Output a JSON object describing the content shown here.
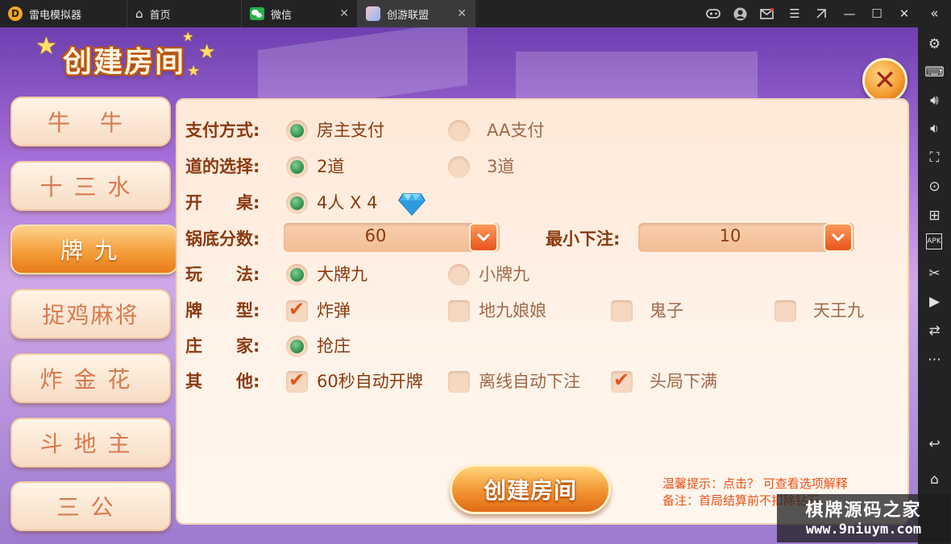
{
  "titlebar": {
    "app_name": "雷电模拟器",
    "tabs": [
      {
        "label": "首页"
      },
      {
        "label": "微信"
      },
      {
        "label": "创游联盟"
      }
    ]
  },
  "game": {
    "header_title": "创建房间",
    "game_list": [
      {
        "label": "牛  牛"
      },
      {
        "label": "十三水"
      },
      {
        "label": "牌九"
      },
      {
        "label": "捉鸡麻将"
      },
      {
        "label": "炸金花"
      },
      {
        "label": "斗地主"
      },
      {
        "label": "三公"
      }
    ],
    "active_game": "牌九",
    "form": {
      "payment": {
        "label": "支付方式:",
        "options": [
          "房主支付",
          "AA支付"
        ],
        "selected": "房主支付"
      },
      "lanes": {
        "label": "道的选择:",
        "options": [
          "2道",
          "3道"
        ],
        "selected": "2道"
      },
      "table": {
        "label": "开　　桌:",
        "option": "4人 X 4",
        "selected": true
      },
      "base_score": {
        "label": "锅底分数:",
        "value": "60"
      },
      "min_bet": {
        "label": "最小下注:",
        "value": "10"
      },
      "play_mode": {
        "label": "玩　　法:",
        "options": [
          "大牌九",
          "小牌九"
        ],
        "selected": "大牌九"
      },
      "card_types": {
        "label": "牌　　型:",
        "options": [
          {
            "text": "炸弹",
            "checked": true
          },
          {
            "text": "地九娘娘",
            "checked": false
          },
          {
            "text": "鬼子",
            "checked": false
          },
          {
            "text": "天王九",
            "checked": false
          }
        ]
      },
      "banker": {
        "label": "庄　　家:",
        "option": "抢庄",
        "selected": true
      },
      "other": {
        "label": "其　　他:",
        "options": [
          {
            "text": "60秒自动开牌",
            "checked": true
          },
          {
            "text": "离线自动下注",
            "checked": false
          },
          {
            "text": "头局下满",
            "checked": true
          }
        ]
      }
    },
    "create_button": "创建房间",
    "hint1": "温馨提示：点击？ 可查看选项解释",
    "hint2": "备注：首局结算前不扣除钻石"
  },
  "watermark": {
    "line1": "棋牌源码之家",
    "line2": "www.9niuym.com"
  },
  "colors": {
    "accent": "#f29432",
    "label": "#8a3a10",
    "radio_on": "#2d8a4c",
    "check_on": "#e1541b",
    "hint": "#e8531a"
  },
  "icons": [
    "app-logo-icon",
    "home-icon",
    "wechat-icon",
    "game-icon",
    "gamepad-icon",
    "user-icon",
    "mail-icon",
    "menu-icon",
    "pin-icon",
    "minimize-icon",
    "maximize-icon",
    "window-close-icon",
    "collapse-icon",
    "settings-icon",
    "keyboard-icon",
    "volume-up-icon",
    "volume-down-icon",
    "screenshot-icon",
    "record-icon",
    "add-window-icon",
    "apk-icon",
    "scissors-icon",
    "video-icon",
    "sync-icon",
    "more-icon",
    "back-icon",
    "home-nav-icon"
  ]
}
